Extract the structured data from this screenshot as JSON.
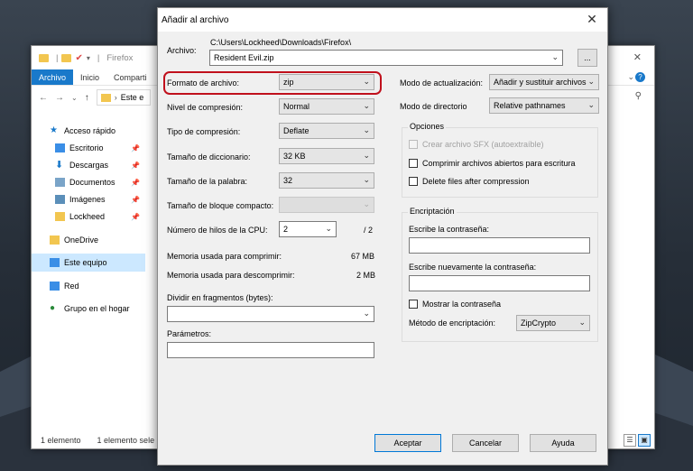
{
  "explorer": {
    "title": "Firefox",
    "title_sep": "|",
    "tabs": [
      "Archivo",
      "Inicio",
      "Comparti"
    ],
    "address_tail": "Este e",
    "nav": [
      {
        "label": "Acceso rápido",
        "icon": "star-icon",
        "pinned": false
      },
      {
        "label": "Escritorio",
        "icon": "desktop-icon",
        "pinned": true
      },
      {
        "label": "Descargas",
        "icon": "download-icon",
        "pinned": true
      },
      {
        "label": "Documentos",
        "icon": "documents-icon",
        "pinned": true
      },
      {
        "label": "Imágenes",
        "icon": "pictures-icon",
        "pinned": true
      },
      {
        "label": "Lockheed",
        "icon": "folder-icon",
        "pinned": true
      },
      {
        "label": "OneDrive",
        "icon": "folder-icon",
        "pinned": false
      },
      {
        "label": "Este equipo",
        "icon": "computer-icon",
        "pinned": false
      },
      {
        "label": "Red",
        "icon": "network-icon",
        "pinned": false
      },
      {
        "label": "Grupo en el hogar",
        "icon": "homegroup-icon",
        "pinned": false
      }
    ],
    "status_items": "1 elemento",
    "status_selected": "1 elemento sele"
  },
  "dialog": {
    "title": "Añadir al archivo",
    "archive_label": "Archivo:",
    "archive_path": "C:\\Users\\Lockheed\\Downloads\\Firefox\\",
    "archive_name": "Resident Evil.zip",
    "browse_label": "...",
    "left": {
      "format_label": "Formato de archivo:",
      "format_value": "zip",
      "level_label": "Nivel de compresión:",
      "level_value": "Normal",
      "method_label": "Tipo de compresión:",
      "method_value": "Deflate",
      "dict_label": "Tamaño de diccionario:",
      "dict_value": "32 KB",
      "word_label": "Tamaño de la palabra:",
      "word_value": "32",
      "solid_label": "Tamaño de bloque compacto:",
      "solid_value": "",
      "threads_label": "Número de hilos de la CPU:",
      "threads_value": "2",
      "threads_total": "/ 2",
      "mem_comp_label": "Memoria usada para comprimir:",
      "mem_comp_value": "67 MB",
      "mem_decomp_label": "Memoria usada para descomprimir:",
      "mem_decomp_value": "2 MB",
      "split_label": "Dividir en fragmentos (bytes):",
      "split_value": "",
      "params_label": "Parámetros:",
      "params_value": ""
    },
    "right": {
      "update_label": "Modo de actualización:",
      "update_value": "Añadir y sustituir archivos",
      "path_label": "Modo de directorio",
      "path_value": "Relative pathnames",
      "options_title": "Opciones",
      "opt_sfx": "Crear archivo SFX (autoextraíble)",
      "opt_shared": "Comprimir archivos abiertos para escritura",
      "opt_delete": "Delete files after compression",
      "enc_title": "Encriptación",
      "pwd_label": "Escribe la contraseña:",
      "pwd2_label": "Escribe nuevamente la contraseña:",
      "show_pwd": "Mostrar la contraseña",
      "enc_method_label": "Método de encriptación:",
      "enc_method_value": "ZipCrypto"
    },
    "buttons": {
      "ok": "Aceptar",
      "cancel": "Cancelar",
      "help": "Ayuda"
    }
  },
  "colors": {
    "highlight": "#c0101c",
    "accent": "#1979ca"
  }
}
